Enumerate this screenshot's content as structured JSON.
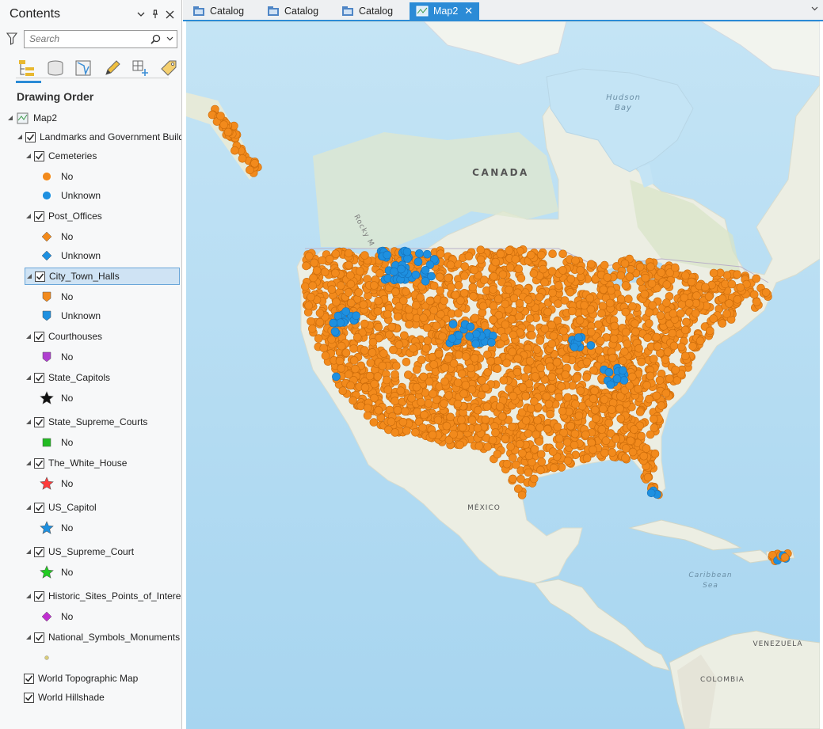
{
  "contents": {
    "title": "Contents",
    "search_placeholder": "Search",
    "drawing_order": "Drawing Order",
    "map_name": "Map2",
    "group_layer": "Landmarks and Government Buildings",
    "layers": [
      {
        "name": "Cemeteries",
        "classes": [
          {
            "label": "No",
            "symbol": "circle",
            "color": "#f28a1c"
          },
          {
            "label": "Unknown",
            "symbol": "circle",
            "color": "#1e90e0"
          }
        ]
      },
      {
        "name": "Post_Offices",
        "classes": [
          {
            "label": "No",
            "symbol": "diamond",
            "color": "#f28a1c"
          },
          {
            "label": "Unknown",
            "symbol": "diamond",
            "color": "#1e90e0"
          }
        ]
      },
      {
        "name": "City_Town_Halls",
        "selected": true,
        "classes": [
          {
            "label": "No",
            "symbol": "pin",
            "color": "#f28a1c"
          },
          {
            "label": "Unknown",
            "symbol": "pin",
            "color": "#1e90e0"
          }
        ]
      },
      {
        "name": "Courthouses",
        "classes": [
          {
            "label": "No",
            "symbol": "pin",
            "color": "#b040d0"
          }
        ]
      },
      {
        "name": "State_Capitols",
        "classes": [
          {
            "label": "No",
            "symbol": "star",
            "color": "#111111"
          }
        ]
      },
      {
        "name": "State_Supreme_Courts",
        "classes": [
          {
            "label": "No",
            "symbol": "square",
            "color": "#22bb22"
          }
        ]
      },
      {
        "name": "The_White_House",
        "classes": [
          {
            "label": "No",
            "symbol": "star",
            "color": "#ff3b3b"
          }
        ]
      },
      {
        "name": "US_Capitol",
        "classes": [
          {
            "label": "No",
            "symbol": "star",
            "color": "#1e90e0"
          }
        ]
      },
      {
        "name": "US_Supreme_Court",
        "classes": [
          {
            "label": "No",
            "symbol": "star",
            "color": "#22cc22"
          }
        ]
      },
      {
        "name": "Historic_Sites_Points_of_Interest",
        "classes": [
          {
            "label": "No",
            "symbol": "diamond",
            "color": "#c030d0"
          }
        ]
      },
      {
        "name": "National_Symbols_Monuments",
        "classes": [
          {
            "label": "",
            "symbol": "dot",
            "color": "#d8cc7a"
          }
        ]
      }
    ],
    "basemaps": [
      "World Topographic Map",
      "World Hillshade"
    ]
  },
  "tabs": [
    {
      "label": "Catalog",
      "active": false
    },
    {
      "label": "Catalog",
      "active": false
    },
    {
      "label": "Catalog",
      "active": false
    },
    {
      "label": "Map2",
      "active": true
    }
  ],
  "map_labels": {
    "hudson": "Hudson",
    "bay": "Bay",
    "canada": "CANADA",
    "rocky": "Rocky M",
    "mexico": "MÉXICO",
    "caribbean": "Caribbean",
    "sea": "Sea",
    "venezuela": "VENEZUELA",
    "colombia": "COLOMBIA"
  },
  "colors": {
    "accent": "#2b8bd6",
    "orange": "#f28a1c",
    "blue": "#1e90e0",
    "ocean": "#b3dcf3",
    "land": "#eef0e6"
  }
}
